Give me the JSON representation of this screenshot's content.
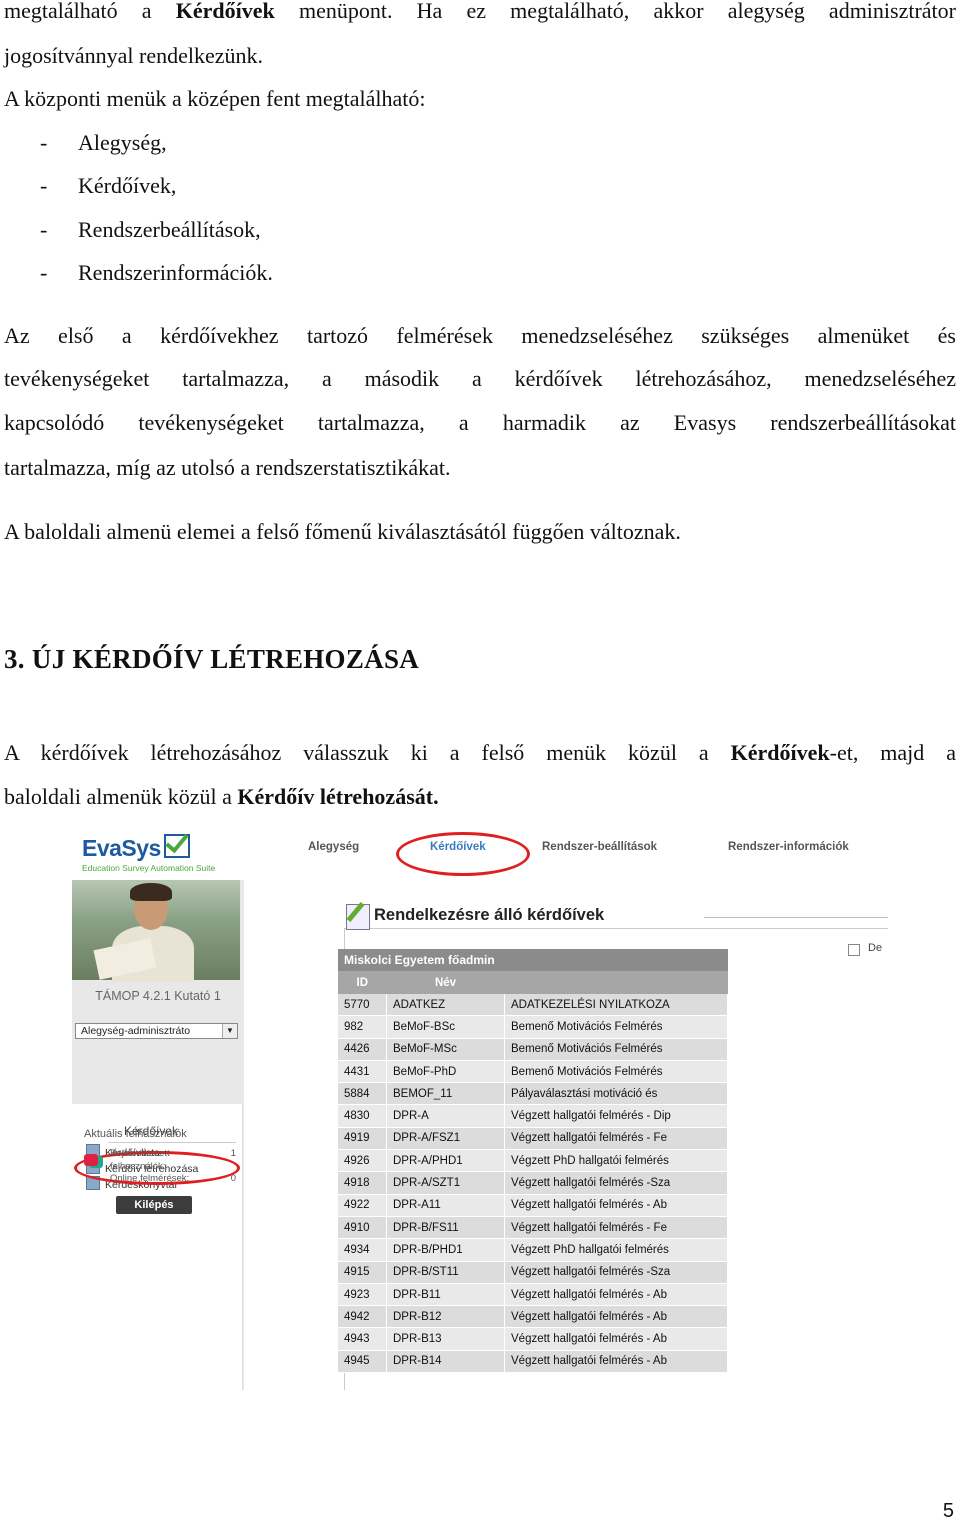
{
  "doc": {
    "p1_line1_pre": "megtalálható a ",
    "p1_line1_bold": "Kérdőívek",
    "p1_line1_post": " menüpont. Ha ez megtalálható, akkor alegység adminisztrátor",
    "p1_line2": "jogosítvánnyal rendelkezünk.",
    "p2": "A központi menük a középen fent megtalálható:",
    "bullets": [
      "Alegység,",
      "Kérdőívek,",
      "Rendszerbeállítások,",
      "Rendszerinformációk."
    ],
    "p3_lines": [
      "Az első a kérdőívekhez tartozó felmérések menedzseléséhez szükséges almenüket és",
      "tevékenységeket tartalmazza, a második a kérdőívek létrehozásához, menedzseléséhez",
      "kapcsolódó tevékenységeket tartalmazza, a harmadik az Evasys rendszerbeállításokat",
      "tartalmazza, míg az utolsó a rendszerstatisztikákat."
    ],
    "p4": "A baloldali almenü elemei a felső főmenű kiválasztásától függően változnak.",
    "heading": "3.  ÚJ KÉRDŐÍV LÉTREHOZÁSA",
    "p5_line1_pre": "A kérdőívek létrehozásához válasszuk ki a felső menük közül a ",
    "p5_line1_bold": "Kérdőívek",
    "p5_line1_post": "-et, majd a",
    "p5_line2_pre": "baloldali almenük közül a ",
    "p5_line2_bold": "Kérdőív létrehozását.",
    "page_number": "5"
  },
  "screenshot": {
    "logo_text": "EvaSys",
    "logo_tagline": "Education Survey Automation Suite",
    "menu": [
      "Alegység",
      "Kérdőívek",
      "Rendszer-beállítások",
      "Rendszer-információk"
    ],
    "unit_name": "TÁMOP 4.2.1 Kutató 1",
    "unit_select": "Alegység-adminisztráto",
    "submenu_title": "Kérdőívek",
    "submenu_items": [
      "Kérdőívlista",
      "Kérdőív létrehozása",
      "Kérdéskönyvtár"
    ],
    "active_users_title": "Aktuális felhasználók",
    "logged_in_label": "Bejelentkezett felhasználók:",
    "logged_in_value": "1",
    "online_label": "Online felmérések:",
    "online_value": "0",
    "logout_label": "Kilépés",
    "panel_title": "Rendelkezésre álló kérdőívek",
    "checkbox_label": "De",
    "table_caption": "Miskolci Egyetem főadmin",
    "table_headers": [
      "ID",
      "Név",
      ""
    ],
    "rows": [
      [
        "5770",
        "ADATKEZ",
        "ADATKEZELÉSI NYILATKOZA"
      ],
      [
        "982",
        "BeMoF-BSc",
        "Bemenő Motivációs Felmérés"
      ],
      [
        "4426",
        "BeMoF-MSc",
        "Bemenő Motivációs Felmérés"
      ],
      [
        "4431",
        "BeMoF-PhD",
        "Bemenő Motivációs Felmérés"
      ],
      [
        "5884",
        "BEMOF_11",
        "Pályaválasztási motiváció és"
      ],
      [
        "4830",
        "DPR-A",
        "Végzett hallgatói felmérés - Dip"
      ],
      [
        "4919",
        "DPR-A/FSZ1",
        "Végzett hallgatói felmérés - Fe"
      ],
      [
        "4926",
        "DPR-A/PHD1",
        "Végzett PhD hallgatói felmérés"
      ],
      [
        "4918",
        "DPR-A/SZT1",
        "Végzett hallgatói felmérés -Sza"
      ],
      [
        "4922",
        "DPR-A11",
        "Végzett hallgatói felmérés - Ab"
      ],
      [
        "4910",
        "DPR-B/FS11",
        "Végzett hallgatói felmérés - Fe"
      ],
      [
        "4934",
        "DPR-B/PHD1",
        "Végzett PhD hallgatói felmérés"
      ],
      [
        "4915",
        "DPR-B/ST11",
        "Végzett hallgatói felmérés -Sza"
      ],
      [
        "4923",
        "DPR-B11",
        "Végzett hallgatói felmérés - Ab"
      ],
      [
        "4942",
        "DPR-B12",
        "Végzett hallgatói felmérés - Ab"
      ],
      [
        "4943",
        "DPR-B13",
        "Végzett hallgatói felmérés - Ab"
      ],
      [
        "4945",
        "DPR-B14",
        "Végzett hallgatói felmérés - Ab"
      ]
    ]
  }
}
